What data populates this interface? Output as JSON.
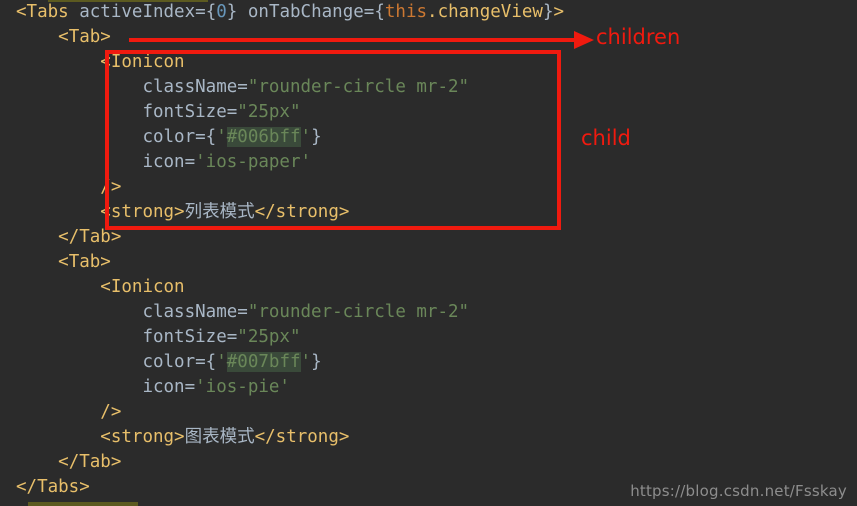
{
  "editor": {
    "language": "jsx",
    "background_color": "#2b2b2b",
    "default_text_color": "#a9b7c6",
    "selection_bar_color": "#5c5a20",
    "highlight_color": "#3a4a3a",
    "lines": [
      {
        "indent": "",
        "tokens": [
          {
            "text": "<Tabs",
            "cls": "tag"
          },
          {
            "text": " ",
            "cls": "punct"
          },
          {
            "text": "activeIndex",
            "cls": "attr"
          },
          {
            "text": "=",
            "cls": "punct"
          },
          {
            "text": "{",
            "cls": "brace"
          },
          {
            "text": "0",
            "cls": "num"
          },
          {
            "text": "}",
            "cls": "brace"
          },
          {
            "text": " ",
            "cls": "punct"
          },
          {
            "text": "onTabChange",
            "cls": "attr"
          },
          {
            "text": "=",
            "cls": "punct"
          },
          {
            "text": "{",
            "cls": "brace"
          },
          {
            "text": "this",
            "cls": "kw"
          },
          {
            "text": ".changeView",
            "cls": "prop"
          },
          {
            "text": "}",
            "cls": "brace"
          },
          {
            "text": ">",
            "cls": "tag"
          }
        ]
      },
      {
        "indent": "    ",
        "tokens": [
          {
            "text": "<Tab>",
            "cls": "tag"
          }
        ]
      },
      {
        "indent": "        ",
        "tokens": [
          {
            "text": "<Ionicon",
            "cls": "tag"
          }
        ]
      },
      {
        "indent": "            ",
        "tokens": [
          {
            "text": "className",
            "cls": "attr"
          },
          {
            "text": "=",
            "cls": "punct"
          },
          {
            "text": "\"rounder-circle mr-2\"",
            "cls": "str"
          }
        ]
      },
      {
        "indent": "            ",
        "tokens": [
          {
            "text": "fontSize",
            "cls": "attr"
          },
          {
            "text": "=",
            "cls": "punct"
          },
          {
            "text": "\"25px\"",
            "cls": "str"
          }
        ]
      },
      {
        "indent": "            ",
        "tokens": [
          {
            "text": "color",
            "cls": "attr"
          },
          {
            "text": "=",
            "cls": "punct"
          },
          {
            "text": "{",
            "cls": "brace"
          },
          {
            "text": "'",
            "cls": "str"
          },
          {
            "text": "#006bff",
            "cls": "str hexhl"
          },
          {
            "text": "'",
            "cls": "str"
          },
          {
            "text": "}",
            "cls": "brace"
          }
        ]
      },
      {
        "indent": "            ",
        "tokens": [
          {
            "text": "icon",
            "cls": "attr"
          },
          {
            "text": "=",
            "cls": "punct"
          },
          {
            "text": "'ios-paper'",
            "cls": "str"
          }
        ]
      },
      {
        "indent": "        ",
        "tokens": [
          {
            "text": "/>",
            "cls": "tag"
          }
        ]
      },
      {
        "indent": "        ",
        "tokens": [
          {
            "text": "<strong>",
            "cls": "tag"
          },
          {
            "text": "列表模式",
            "cls": "cjk"
          },
          {
            "text": "</strong>",
            "cls": "tag"
          }
        ]
      },
      {
        "indent": "    ",
        "tokens": [
          {
            "text": "</Tab>",
            "cls": "tag"
          }
        ]
      },
      {
        "indent": "    ",
        "tokens": [
          {
            "text": "<Tab>",
            "cls": "tag"
          }
        ]
      },
      {
        "indent": "        ",
        "tokens": [
          {
            "text": "<Ionicon",
            "cls": "tag"
          }
        ]
      },
      {
        "indent": "            ",
        "tokens": [
          {
            "text": "className",
            "cls": "attr"
          },
          {
            "text": "=",
            "cls": "punct"
          },
          {
            "text": "\"rounder-circle mr-2\"",
            "cls": "str"
          }
        ]
      },
      {
        "indent": "            ",
        "tokens": [
          {
            "text": "fontSize",
            "cls": "attr"
          },
          {
            "text": "=",
            "cls": "punct"
          },
          {
            "text": "\"25px\"",
            "cls": "str"
          }
        ]
      },
      {
        "indent": "            ",
        "tokens": [
          {
            "text": "color",
            "cls": "attr"
          },
          {
            "text": "=",
            "cls": "punct"
          },
          {
            "text": "{",
            "cls": "brace"
          },
          {
            "text": "'",
            "cls": "str"
          },
          {
            "text": "#007bff",
            "cls": "str hexhl"
          },
          {
            "text": "'",
            "cls": "str"
          },
          {
            "text": "}",
            "cls": "brace"
          }
        ]
      },
      {
        "indent": "            ",
        "tokens": [
          {
            "text": "icon",
            "cls": "attr"
          },
          {
            "text": "=",
            "cls": "punct"
          },
          {
            "text": "'ios-pie'",
            "cls": "str"
          }
        ]
      },
      {
        "indent": "        ",
        "tokens": [
          {
            "text": "/>",
            "cls": "tag"
          }
        ]
      },
      {
        "indent": "        ",
        "tokens": [
          {
            "text": "<strong>",
            "cls": "tag"
          },
          {
            "text": "图表模式",
            "cls": "cjk"
          },
          {
            "text": "</strong>",
            "cls": "tag"
          }
        ]
      },
      {
        "indent": "    ",
        "tokens": [
          {
            "text": "</Tab>",
            "cls": "tag"
          }
        ]
      },
      {
        "indent": "",
        "tokens": [
          {
            "text": "</Tabs>",
            "cls": "tag"
          }
        ]
      }
    ]
  },
  "annotations": {
    "color": "#f01a0f",
    "children_label": "children",
    "child_label": "child"
  },
  "watermark": {
    "text": "https://blog.csdn.net/Fsskay"
  }
}
